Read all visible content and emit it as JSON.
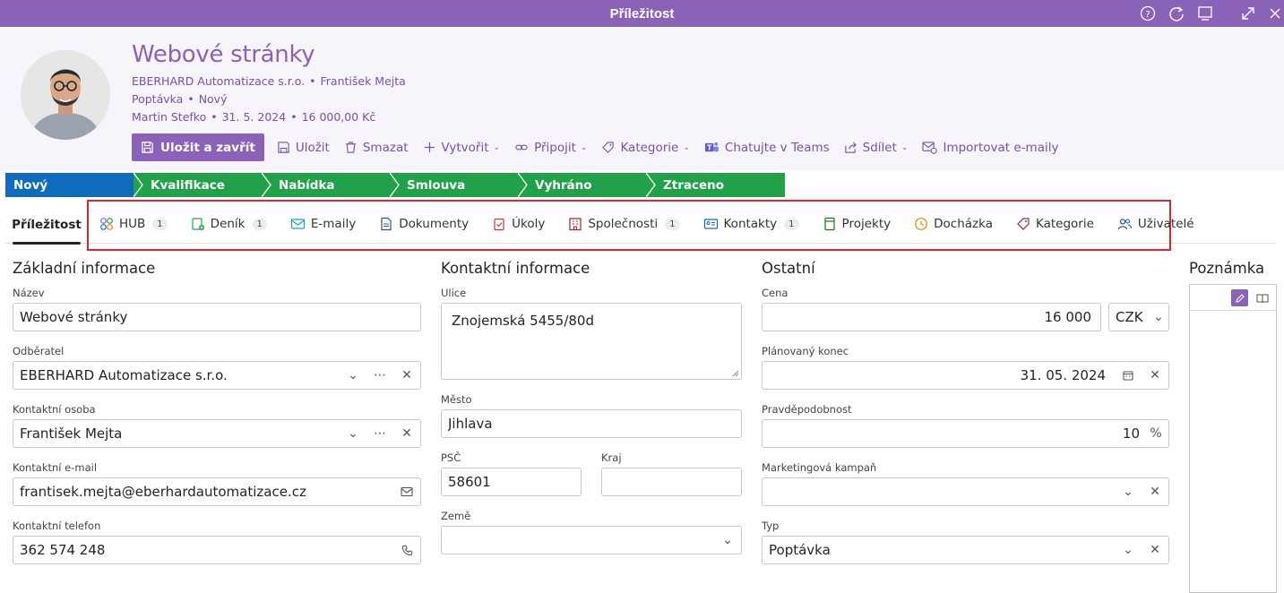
{
  "window": {
    "title": "Příležitost"
  },
  "record": {
    "title": "Webové stránky",
    "customer": "EBERHARD Automatizace s.r.o.",
    "contact": "František Mejta",
    "type": "Poptávka",
    "status": "Nový",
    "owner": "Martin Stefko",
    "date": "31. 5. 2024",
    "amount": "16 000,00 Kč"
  },
  "toolbar": {
    "save_close": "Uložit a zavřít",
    "save": "Uložit",
    "delete": "Smazat",
    "create": "Vytvořit",
    "attach": "Připojit",
    "category": "Kategorie",
    "teams": "Chatujte v Teams",
    "share": "Sdílet",
    "import": "Importovat e-maily"
  },
  "stages": [
    "Nový",
    "Kvalifikace",
    "Nabídka",
    "Smlouva",
    "Vyhráno",
    "Ztraceno"
  ],
  "colors": {
    "accent": "#8a62b8",
    "stage_active": "#0f6cbd",
    "stage_other": "#21a24a",
    "highlight": "#e0242e"
  },
  "tabs": {
    "active": "Příležitost",
    "items": [
      {
        "label": "HUB",
        "badge": "1",
        "icon": "hub-icon"
      },
      {
        "label": "Deník",
        "badge": "1",
        "icon": "journal-icon"
      },
      {
        "label": "E-maily",
        "badge": "",
        "icon": "mail-icon"
      },
      {
        "label": "Dokumenty",
        "badge": "",
        "icon": "document-icon"
      },
      {
        "label": "Úkoly",
        "badge": "",
        "icon": "task-icon"
      },
      {
        "label": "Společnosti",
        "badge": "1",
        "icon": "company-icon"
      },
      {
        "label": "Kontakty",
        "badge": "1",
        "icon": "contact-card-icon"
      },
      {
        "label": "Projekty",
        "badge": "",
        "icon": "project-icon"
      },
      {
        "label": "Docházka",
        "badge": "",
        "icon": "clock-icon"
      },
      {
        "label": "Kategorie",
        "badge": "",
        "icon": "tag-icon"
      },
      {
        "label": "Uživatelé",
        "badge": "",
        "icon": "users-icon"
      }
    ]
  },
  "basic": {
    "heading": "Základní informace",
    "name_label": "Název",
    "name_value": "Webové stránky",
    "customer_label": "Odběratel",
    "customer_value": "EBERHARD Automatizace s.r.o.",
    "contact_label": "Kontaktní osoba",
    "contact_value": "František Mejta",
    "email_label": "Kontaktní e-mail",
    "email_value": "frantisek.mejta@eberhardautomatizace.cz",
    "phone_label": "Kontaktní telefon",
    "phone_value": "362 574 248"
  },
  "contact_info": {
    "heading": "Kontaktní informace",
    "street_label": "Ulice",
    "street_value": "Znojemská 5455/80d",
    "city_label": "Město",
    "city_value": "Jihlava",
    "zip_label": "PSČ",
    "zip_value": "58601",
    "region_label": "Kraj",
    "region_value": "",
    "country_label": "Země",
    "country_value": ""
  },
  "other": {
    "heading": "Ostatní",
    "price_label": "Cena",
    "price_value": "16 000",
    "currency": "CZK",
    "end_label": "Plánovaný konec",
    "end_value": "31. 05. 2024",
    "prob_label": "Pravděpodobnost",
    "prob_value": "10",
    "prob_unit": "%",
    "campaign_label": "Marketingová kampaň",
    "campaign_value": "",
    "type_label": "Typ",
    "type_value": "Poptávka"
  },
  "note": {
    "heading": "Poznámka"
  }
}
